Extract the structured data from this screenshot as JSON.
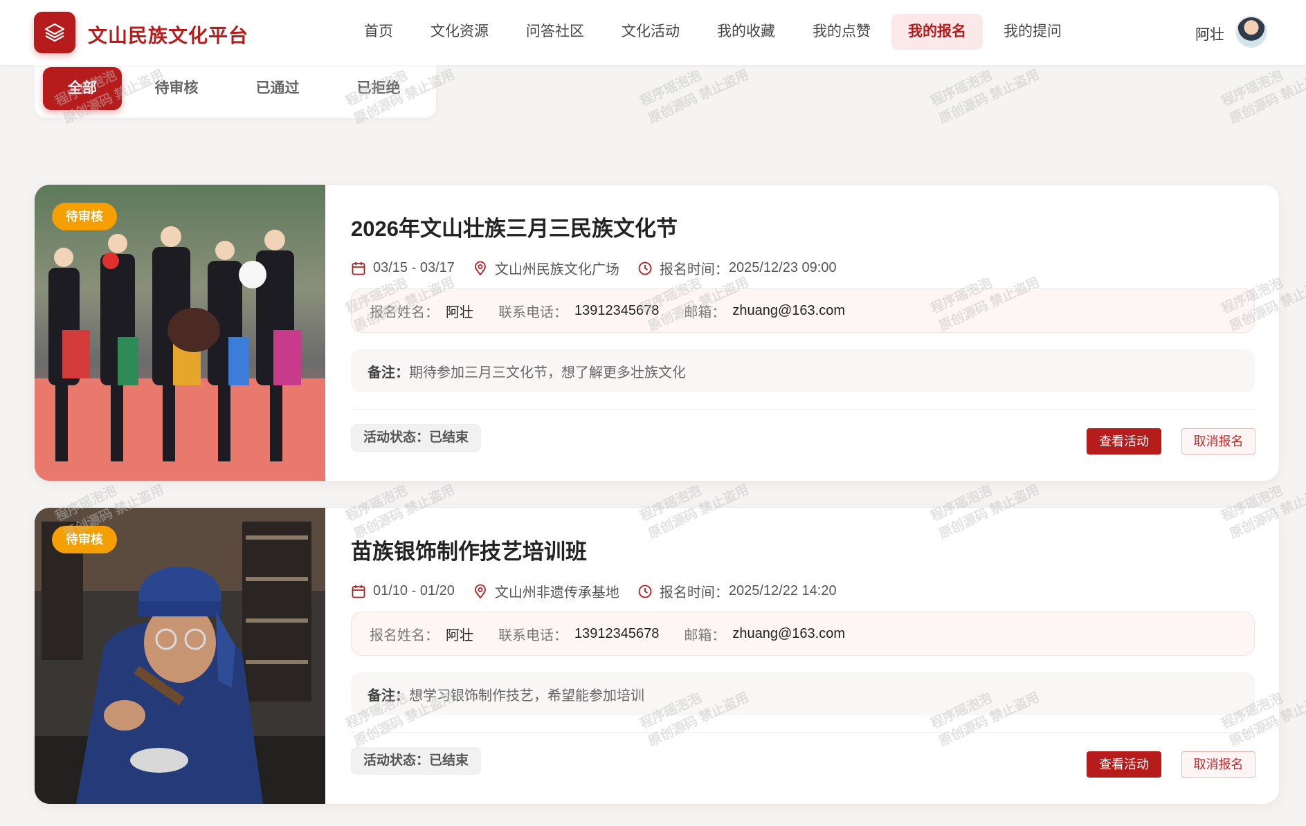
{
  "header": {
    "brand": "文山民族文化平台",
    "nav": [
      "首页",
      "文化资源",
      "问答社区",
      "文化活动",
      "我的收藏",
      "我的点赞",
      "我的报名",
      "我的提问"
    ],
    "nav_active": "我的报名",
    "user_name": "阿壮"
  },
  "filters": {
    "tabs": [
      "全部",
      "待审核",
      "已通过",
      "已拒绝"
    ],
    "active": "全部"
  },
  "registrations": [
    {
      "status": "待审核",
      "title": "2026年文山壮族三月三民族文化节",
      "dates": "03/15 - 03/17",
      "location": "文山州民族文化广场",
      "reg_time_label": "报名时间：",
      "reg_time": "2025/12/23 09:00",
      "name_label": "报名姓名：",
      "name": "阿壮",
      "phone_label": "联系电话：",
      "phone": "13912345678",
      "email_label": "邮箱：",
      "email": "zhuang@163.com",
      "note_label": "备注：",
      "note": "期待参加三月三文化节，想了解更多壮族文化",
      "activity_status": "活动状态：已结束",
      "view_btn": "查看活动",
      "cancel_btn": "取消报名"
    },
    {
      "status": "待审核",
      "title": "苗族银饰制作技艺培训班",
      "dates": "01/10 - 01/20",
      "location": "文山州非遗传承基地",
      "reg_time_label": "报名时间：",
      "reg_time": "2025/12/22 14:20",
      "name_label": "报名姓名：",
      "name": "阿壮",
      "phone_label": "联系电话：",
      "phone": "13912345678",
      "email_label": "邮箱：",
      "email": "zhuang@163.com",
      "note_label": "备注：",
      "note": "想学习银饰制作技艺，希望能参加培训",
      "activity_status": "活动状态：已结束",
      "view_btn": "查看活动",
      "cancel_btn": "取消报名"
    }
  ],
  "watermark": {
    "line1": "程序瑶泡泡",
    "line2": "原创源码 禁止盗用"
  },
  "colors": {
    "primary": "#b71c1c",
    "pending": "#f5a000",
    "background": "#f5f4f3"
  }
}
